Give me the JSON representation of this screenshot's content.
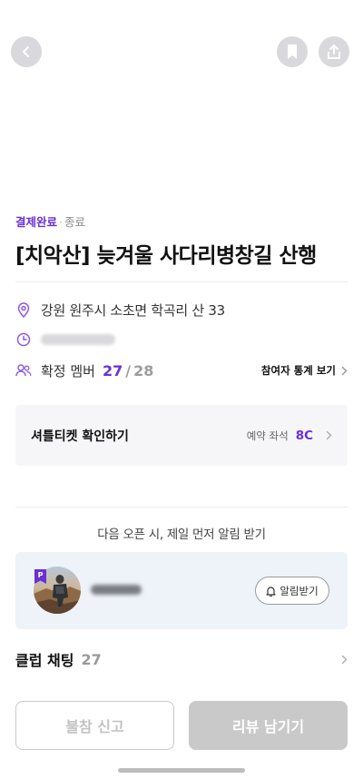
{
  "header": {
    "back_icon": "chevron-left-icon",
    "bookmark_icon": "bookmark-icon",
    "share_icon": "share-icon",
    "button_color": "#d9d9dd"
  },
  "status": {
    "payment": "결제완료",
    "separator": "·",
    "state": "종료"
  },
  "event": {
    "title": "[치악산] 늦겨울 사다리병창길 산행"
  },
  "info": {
    "location": "강원 원주시 소초면 학곡리 산 33",
    "confirmed_label": "확정 멤버",
    "confirmed_count": "27",
    "slash": "/",
    "capacity": "28",
    "stats_link": "참여자 통계 보기"
  },
  "ticket": {
    "title": "셔틀티켓 확인하기",
    "seat_label": "예약 좌석",
    "seat_value": "8C"
  },
  "alert": {
    "text": "다음 오픈 시, 제일 먼저 알림 받기"
  },
  "host": {
    "badge": "P",
    "alarm_button": "알림받기"
  },
  "club": {
    "label": "클럽 채팅",
    "count": "27"
  },
  "actions": {
    "absent_report": "불참 신고",
    "leave_review": "리뷰 남기기"
  },
  "colors": {
    "accent": "#6a2fd6",
    "card_bg": "#f6f6f8",
    "host_card_bg": "#eef3f9",
    "disabled_button": "#c9c9c9"
  }
}
